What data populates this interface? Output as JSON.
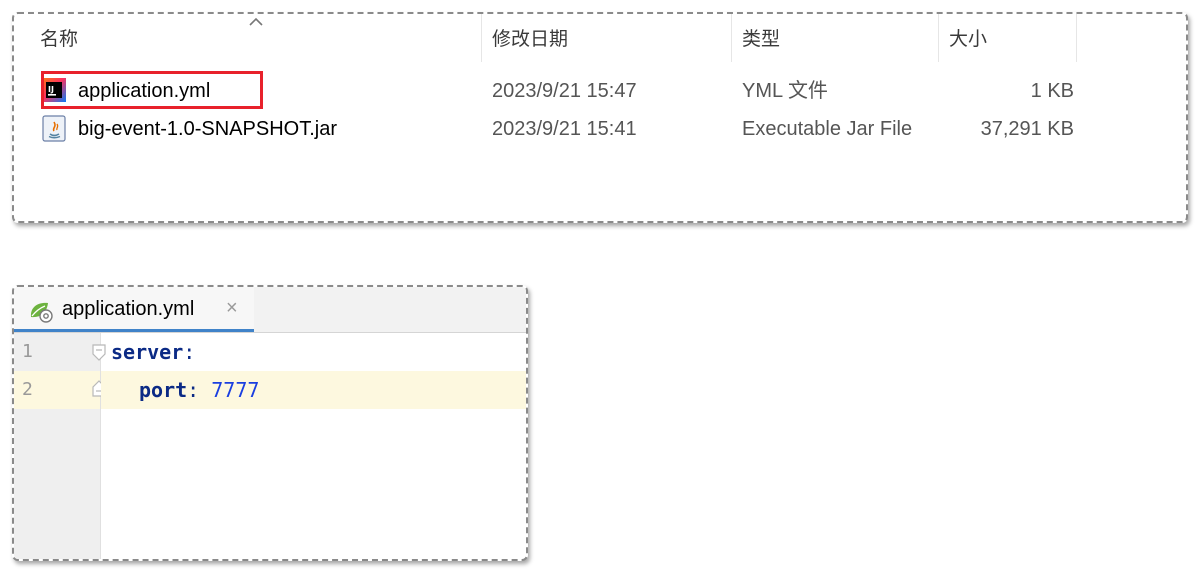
{
  "explorer": {
    "columns": {
      "name": "名称",
      "modified": "修改日期",
      "type": "类型",
      "size": "大小"
    },
    "files": [
      {
        "name": "application.yml",
        "modified": "2023/9/21 15:47",
        "type": "YML 文件",
        "size": "1 KB",
        "icon": "intellij-yml-file-icon",
        "highlighted": true
      },
      {
        "name": "big-event-1.0-SNAPSHOT.jar",
        "modified": "2023/9/21 15:41",
        "type": "Executable Jar File",
        "size": "37,291 KB",
        "icon": "java-jar-file-icon",
        "highlighted": false
      }
    ],
    "highlight_color": "#e8212b"
  },
  "editor": {
    "tab": {
      "label": "application.yml",
      "close": "×",
      "icon": "spring-config-icon"
    },
    "lines": [
      {
        "number": "1",
        "key": "server",
        "sep": ":",
        "value": ""
      },
      {
        "number": "2",
        "key": "port",
        "sep": ":",
        "value": "7777"
      }
    ],
    "colors": {
      "key": "#0b2a85",
      "number": "#1a3fe0",
      "current_line": "#fdf8df"
    }
  }
}
